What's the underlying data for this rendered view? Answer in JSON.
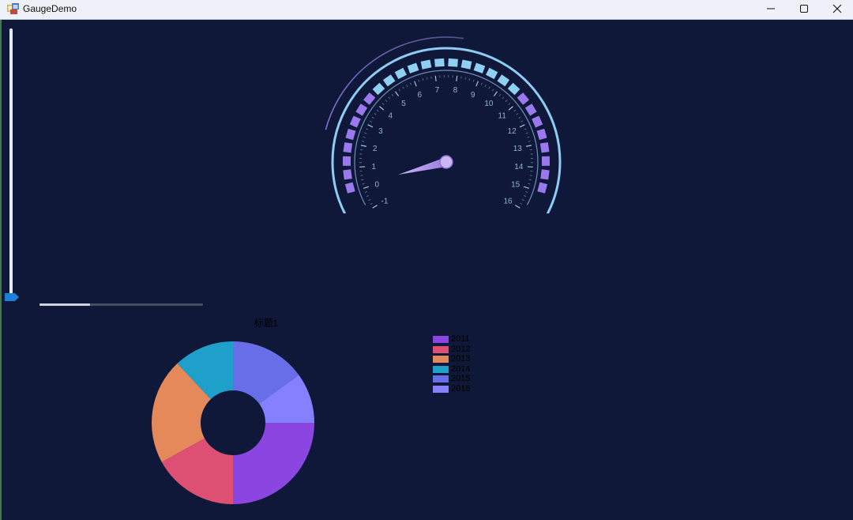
{
  "window": {
    "title": "GaugeDemo"
  },
  "gauge": {
    "min": -1,
    "max": 16,
    "value": 0.2,
    "tick_labels": [
      "-1",
      "0",
      "1",
      "2",
      "3",
      "4",
      "5",
      "6",
      "7",
      "8",
      "9",
      "10",
      "11",
      "12",
      "13",
      "14",
      "15",
      "16"
    ]
  },
  "vertical_slider": {
    "value_fraction": 0.0
  },
  "horizontal_slider": {
    "value_fraction": 0.31
  },
  "chart": {
    "title": "标题1"
  },
  "chart_data": {
    "type": "pie",
    "title": "标题1",
    "categories": [
      "2011",
      "2012",
      "2013",
      "2014",
      "2015",
      "2016"
    ],
    "values": [
      25,
      17,
      21,
      12,
      15,
      10
    ],
    "colors": [
      "#8b45e0",
      "#dd4f73",
      "#e5895a",
      "#1fa0cb",
      "#676ee7",
      "#8580fe"
    ],
    "legend_position": "right"
  }
}
